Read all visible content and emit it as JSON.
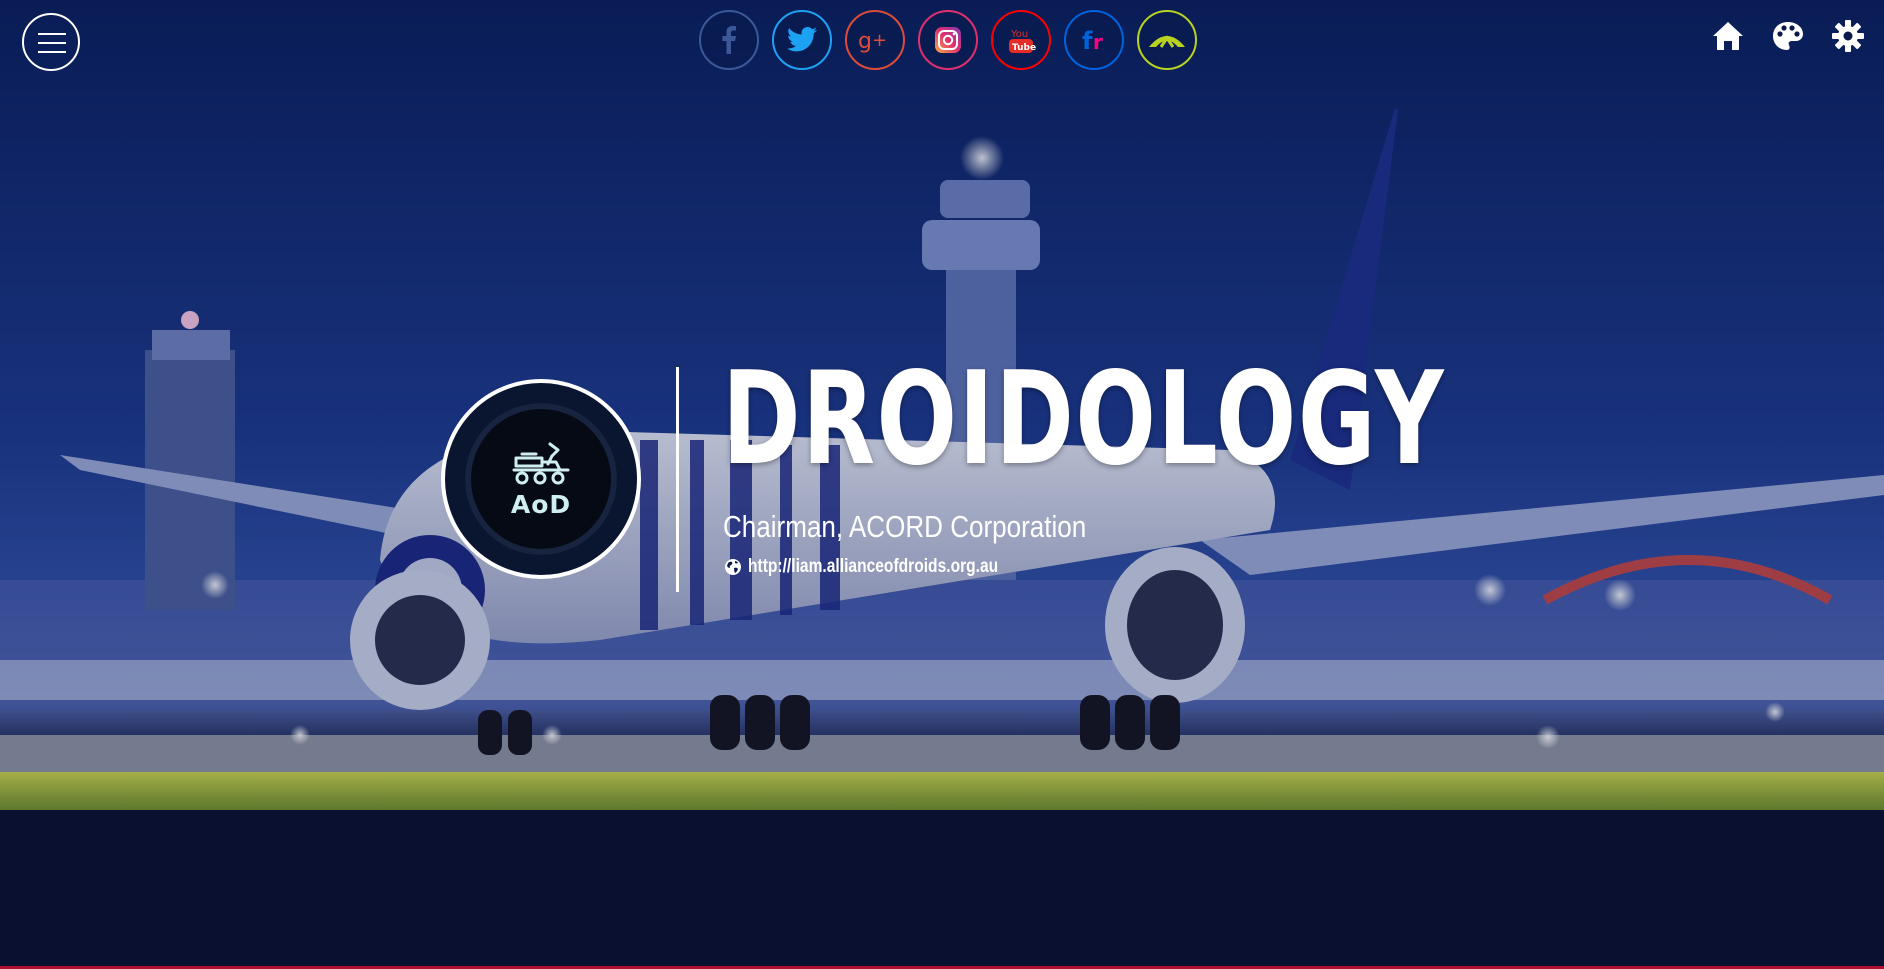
{
  "header": {
    "menu_icon": "hamburger-icon",
    "social_links": [
      {
        "name": "facebook",
        "icon": "facebook-icon",
        "color": "#3b5998"
      },
      {
        "name": "twitter",
        "icon": "twitter-icon",
        "color": "#1da1f2"
      },
      {
        "name": "google-plus",
        "icon": "google-plus-icon",
        "color": "#dd4b39"
      },
      {
        "name": "instagram",
        "icon": "instagram-icon",
        "color": "#e1306c"
      },
      {
        "name": "youtube",
        "icon": "youtube-icon",
        "color": "#ff0000"
      },
      {
        "name": "flickr",
        "icon": "flickr-icon",
        "color": "#0063dc"
      },
      {
        "name": "deviantart",
        "icon": "deviantart-icon",
        "color": "#b8d21f"
      }
    ],
    "right_icons": [
      "home-icon",
      "palette-icon",
      "gear-icon"
    ]
  },
  "profile": {
    "avatar_text": "AoD",
    "title": "DROIDOLOGY",
    "subtitle": "Chairman, ACORD Corporation",
    "url": "http://liam.allianceofdroids.org.au"
  },
  "colors": {
    "accent_footer": "#b01030"
  }
}
